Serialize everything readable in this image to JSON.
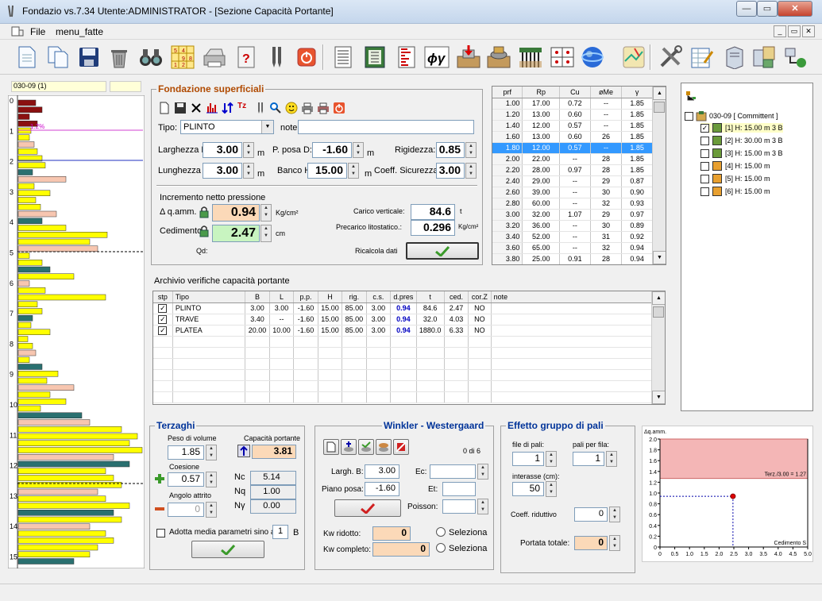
{
  "window": {
    "title": "Fondazio vs.7.34  Utente:ADMINISTRATOR - [Sezione Capacità Portante]",
    "minimize": "—",
    "maximize": "▭",
    "close": "✕"
  },
  "menu": {
    "items": [
      "File",
      "menu_fatte"
    ]
  },
  "left_profile": {
    "header_id": "030-09 (1)",
    "depth_ticks": [
      "0",
      "1",
      "2",
      "3",
      "4",
      "5",
      "6",
      "7",
      "8",
      "9",
      "10",
      "11",
      "12",
      "13",
      "14",
      "15"
    ],
    "marker_label": "1.2%"
  },
  "fondazione": {
    "title": "Fondazione superficiali",
    "tipo_label": "Tipo:",
    "tipo_value": "PLINTO",
    "note_label": "note:",
    "note_value": "",
    "larghezza_label": "Larghezza B:",
    "larghezza_value": "3.00",
    "lunghezza_label": "Lunghezza L:",
    "lunghezza_value": "3.00",
    "pposa_label": "P. posa D:",
    "pposa_value": "-1.60",
    "banco_label": "Banco H:",
    "banco_value": "15.00",
    "rigidezza_label": "Rigidezza:",
    "rigidezza_value": "0.85",
    "coeff_label": "Coeff. Sicurezza:",
    "coeff_value": "3.00",
    "unit_m": "m",
    "incremento_label": "Incremento netto pressione",
    "qamm_label": "Δ q.amm.",
    "qamm_value": "0.94",
    "qamm_unit": "Kg/cm²",
    "cedimento_label": "Cedimento",
    "cedimento_value": "2.47",
    "cedimento_unit": "cm",
    "qd_label": "Qd:",
    "carico_label": "Carico verticale:",
    "carico_value": "84.6",
    "carico_unit": "t",
    "precarico_label": "Precarico litostatico.:",
    "precarico_value": "0.296",
    "precarico_unit": "Kg/cm²",
    "ricalcola_label": "Ricalcola dati"
  },
  "cpt_table": {
    "headers": [
      "prf",
      "Rp",
      "Cu",
      "øMe",
      "γ"
    ],
    "rows": [
      [
        "1.00",
        "17.00",
        "0.72",
        "--",
        "1.85"
      ],
      [
        "1.20",
        "13.00",
        "0.60",
        "--",
        "1.85"
      ],
      [
        "1.40",
        "12.00",
        "0.57",
        "--",
        "1.85"
      ],
      [
        "1.60",
        "13.00",
        "0.60",
        "26",
        "1.85"
      ],
      [
        "1.80",
        "12.00",
        "0.57",
        "--",
        "1.85"
      ],
      [
        "2.00",
        "22.00",
        "--",
        "28",
        "1.85"
      ],
      [
        "2.20",
        "28.00",
        "0.97",
        "28",
        "1.85"
      ],
      [
        "2.40",
        "29.00",
        "--",
        "29",
        "0.87"
      ],
      [
        "2.60",
        "39.00",
        "--",
        "30",
        "0.90"
      ],
      [
        "2.80",
        "60.00",
        "--",
        "32",
        "0.93"
      ],
      [
        "3.00",
        "32.00",
        "1.07",
        "29",
        "0.97"
      ],
      [
        "3.20",
        "36.00",
        "--",
        "30",
        "0.89"
      ],
      [
        "3.40",
        "52.00",
        "--",
        "31",
        "0.92"
      ],
      [
        "3.60",
        "65.00",
        "--",
        "32",
        "0.94"
      ],
      [
        "3.80",
        "25.00",
        "0.91",
        "28",
        "0.94"
      ]
    ],
    "selected_row": 4
  },
  "tree": {
    "root": "030-09 [ Committent ]",
    "items": [
      {
        "label": "[1] H: 15.00 m  3 B",
        "checked": true
      },
      {
        "label": "[2] H: 30.00 m  3 B",
        "checked": false
      },
      {
        "label": "[3] H: 15.00 m  3 B",
        "checked": false
      },
      {
        "label": "[4] H: 15.00 m",
        "checked": false
      },
      {
        "label": "[5] H: 15.00 m",
        "checked": false
      },
      {
        "label": "[6] H: 15.00 m",
        "checked": false
      }
    ]
  },
  "archivio": {
    "title": "Archivio verifiche capacità portante",
    "headers": [
      "stp",
      "Tipo",
      "B",
      "L",
      "p.p.",
      "H",
      "rig.",
      "c.s.",
      "d.pres",
      "t",
      "ced.",
      "cor.Z",
      "note"
    ],
    "rows": [
      [
        "PLINTO",
        "3.00",
        "3.00",
        "-1.60",
        "15.00",
        "85.00",
        "3.00",
        "0.94",
        "84.6",
        "2.47",
        "NO",
        ""
      ],
      [
        "TRAVE",
        "3.40",
        "--",
        "-1.60",
        "15.00",
        "85.00",
        "3.00",
        "0.94",
        "32.0",
        "4.03",
        "NO",
        ""
      ],
      [
        "PLATEA",
        "20.00",
        "10.00",
        "-1.60",
        "15.00",
        "85.00",
        "3.00",
        "0.94",
        "1880.0",
        "6.33",
        "NO",
        ""
      ]
    ]
  },
  "terzaghi": {
    "title": "Terzaghi",
    "peso_label": "Peso di volume",
    "peso_value": "1.85",
    "capacita_label": "Capacità portante",
    "capacita_value": "3.81",
    "coesione_label": "Coesione",
    "coesione_value": "0.57",
    "attrito_label": "Angolo attrito",
    "attrito_value": "0",
    "nc_label": "Nc",
    "nc_value": "5.14",
    "nq_label": "Nq",
    "nq_value": "1.00",
    "ny_label": "Nγ",
    "ny_value": "0.00",
    "media_label": "Adotta media parametri sino a:",
    "media_value": "1",
    "media_unit": "B"
  },
  "winkler": {
    "title": "Winkler - Westergaard",
    "counter": "0 di 6",
    "largh_label": "Largh. B:",
    "largh_value": "3.00",
    "piano_label": "Piano posa:",
    "piano_value": "-1.60",
    "ec_label": "Ec:",
    "et_label": "Et:",
    "poisson_label": "Poisson:",
    "kwr_label": "Kw ridotto:",
    "kwr_value": "0",
    "kwc_label": "Kw completo:",
    "kwc_value": "0",
    "seleziona1": "Seleziona",
    "seleziona2": "Seleziona"
  },
  "gruppo": {
    "title": "Effetto gruppo di pali",
    "file_label": "file di pali:",
    "file_value": "1",
    "pali_label": "pali per fila:",
    "pali_value": "1",
    "interasse_label": "interasse (cm):",
    "interasse_value": "50",
    "coeff_label": "Coeff. riduttivo",
    "coeff_value": "0",
    "portata_label": "Portata totale:",
    "portata_value": "0"
  },
  "chart_data": {
    "type": "scatter",
    "ylabel": "Δq.amm.",
    "xlabel": "Cedimento S",
    "xlim": [
      0,
      5
    ],
    "ylim": [
      0,
      2
    ],
    "x_ticks": [
      "0",
      "0.5",
      "1.0",
      "1.5",
      "2.0",
      "2.5",
      "3.0",
      "3.5",
      "4.0",
      "4.5",
      "5.0"
    ],
    "y_ticks": [
      "0",
      "0.2",
      "0.4",
      "0.6",
      "0.8",
      "1.0",
      "1.2",
      "1.4",
      "1.6",
      "1.8",
      "2.0"
    ],
    "band_label": "Terz./3.00 = 1.27",
    "band_from": 1.27,
    "band_to": 2.0,
    "point": {
      "x": 2.47,
      "y": 0.94
    },
    "colors": {
      "band": "#f4b6b6",
      "point": "#e00000",
      "guide": "#0000aa"
    }
  }
}
